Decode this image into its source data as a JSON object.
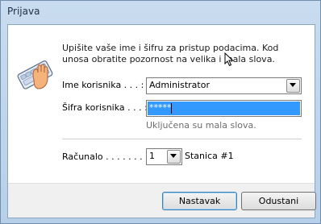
{
  "window": {
    "title": "Prijava"
  },
  "dialog": {
    "instructions": "Upišite vaše ime i šifru za pristup podacima. Kod unosa obratite pozornost na velika i mala slova.",
    "username": {
      "label": "Ime korisnika . . . :",
      "value": "Administrator"
    },
    "password": {
      "label": "Šifra korisnika . . . :",
      "value": "*****"
    },
    "caps_lock_notice": "Uključena su mala slova.",
    "computer": {
      "label": "Računalo . . . . . . . :",
      "value": "1",
      "station": "Stanica #1"
    },
    "icons": [
      "keyboard-hand-icon",
      "chevron-down-icon",
      "mouse-cursor-icon"
    ]
  },
  "buttons": {
    "continue_label": "Nastavak",
    "cancel_label": "Odustani"
  }
}
